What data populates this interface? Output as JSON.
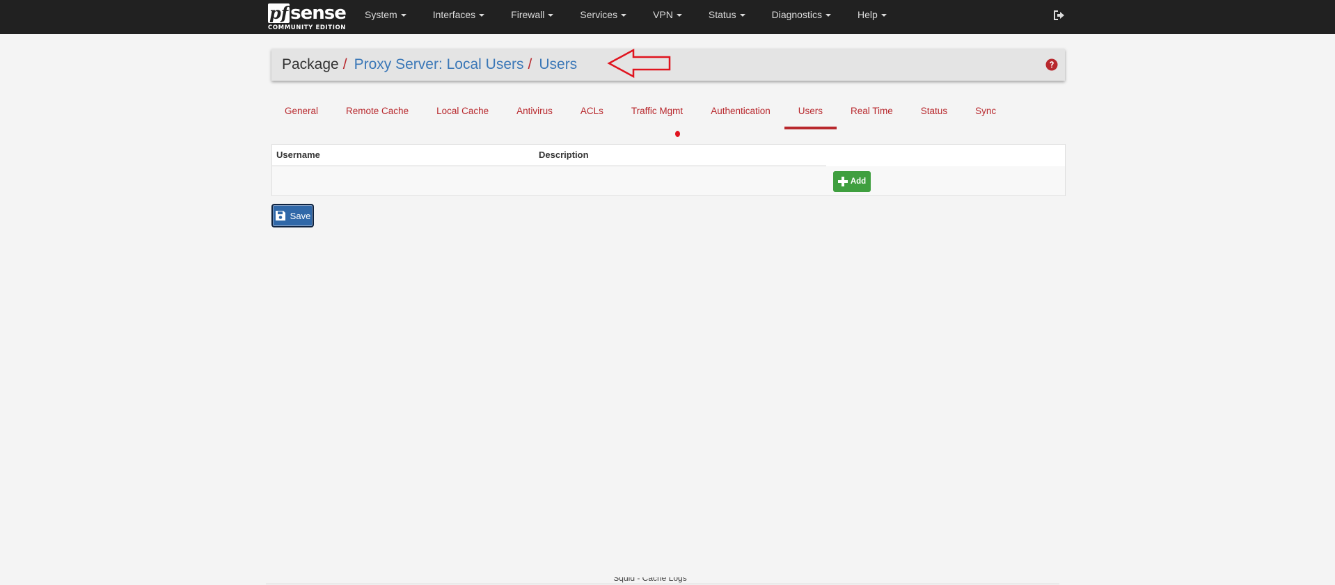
{
  "brand": {
    "logo_pf": "pf",
    "logo_sense": "sense",
    "edition": "COMMUNITY EDITION"
  },
  "nav": {
    "items": [
      {
        "label": "System"
      },
      {
        "label": "Interfaces"
      },
      {
        "label": "Firewall"
      },
      {
        "label": "Services"
      },
      {
        "label": "VPN"
      },
      {
        "label": "Status"
      },
      {
        "label": "Diagnostics"
      },
      {
        "label": "Help"
      }
    ],
    "logout_icon": "sign-out-icon"
  },
  "breadcrumb": {
    "root": "Package",
    "separator": "/",
    "section": "Proxy Server: Local Users",
    "page": "Users",
    "help_icon": "question-circle-icon"
  },
  "tabs": [
    {
      "label": "General",
      "active": false
    },
    {
      "label": "Remote Cache",
      "active": false
    },
    {
      "label": "Local Cache",
      "active": false
    },
    {
      "label": "Antivirus",
      "active": false
    },
    {
      "label": "ACLs",
      "active": false
    },
    {
      "label": "Traffic Mgmt",
      "active": false
    },
    {
      "label": "Authentication",
      "active": false
    },
    {
      "label": "Users",
      "active": true
    },
    {
      "label": "Real Time",
      "active": false
    },
    {
      "label": "Status",
      "active": false
    },
    {
      "label": "Sync",
      "active": false
    }
  ],
  "table": {
    "columns": [
      "Username",
      "Description"
    ],
    "add_label": "Add"
  },
  "save_label": "Save",
  "footer": {
    "text": "Squid - Cache Logs"
  },
  "colors": {
    "navbar": "#212121",
    "accent": "#b8282d",
    "link": "#3a77b7",
    "add_button": "#3f9f3f",
    "save_button": "#3068a8",
    "annotation": "#e0141f"
  }
}
